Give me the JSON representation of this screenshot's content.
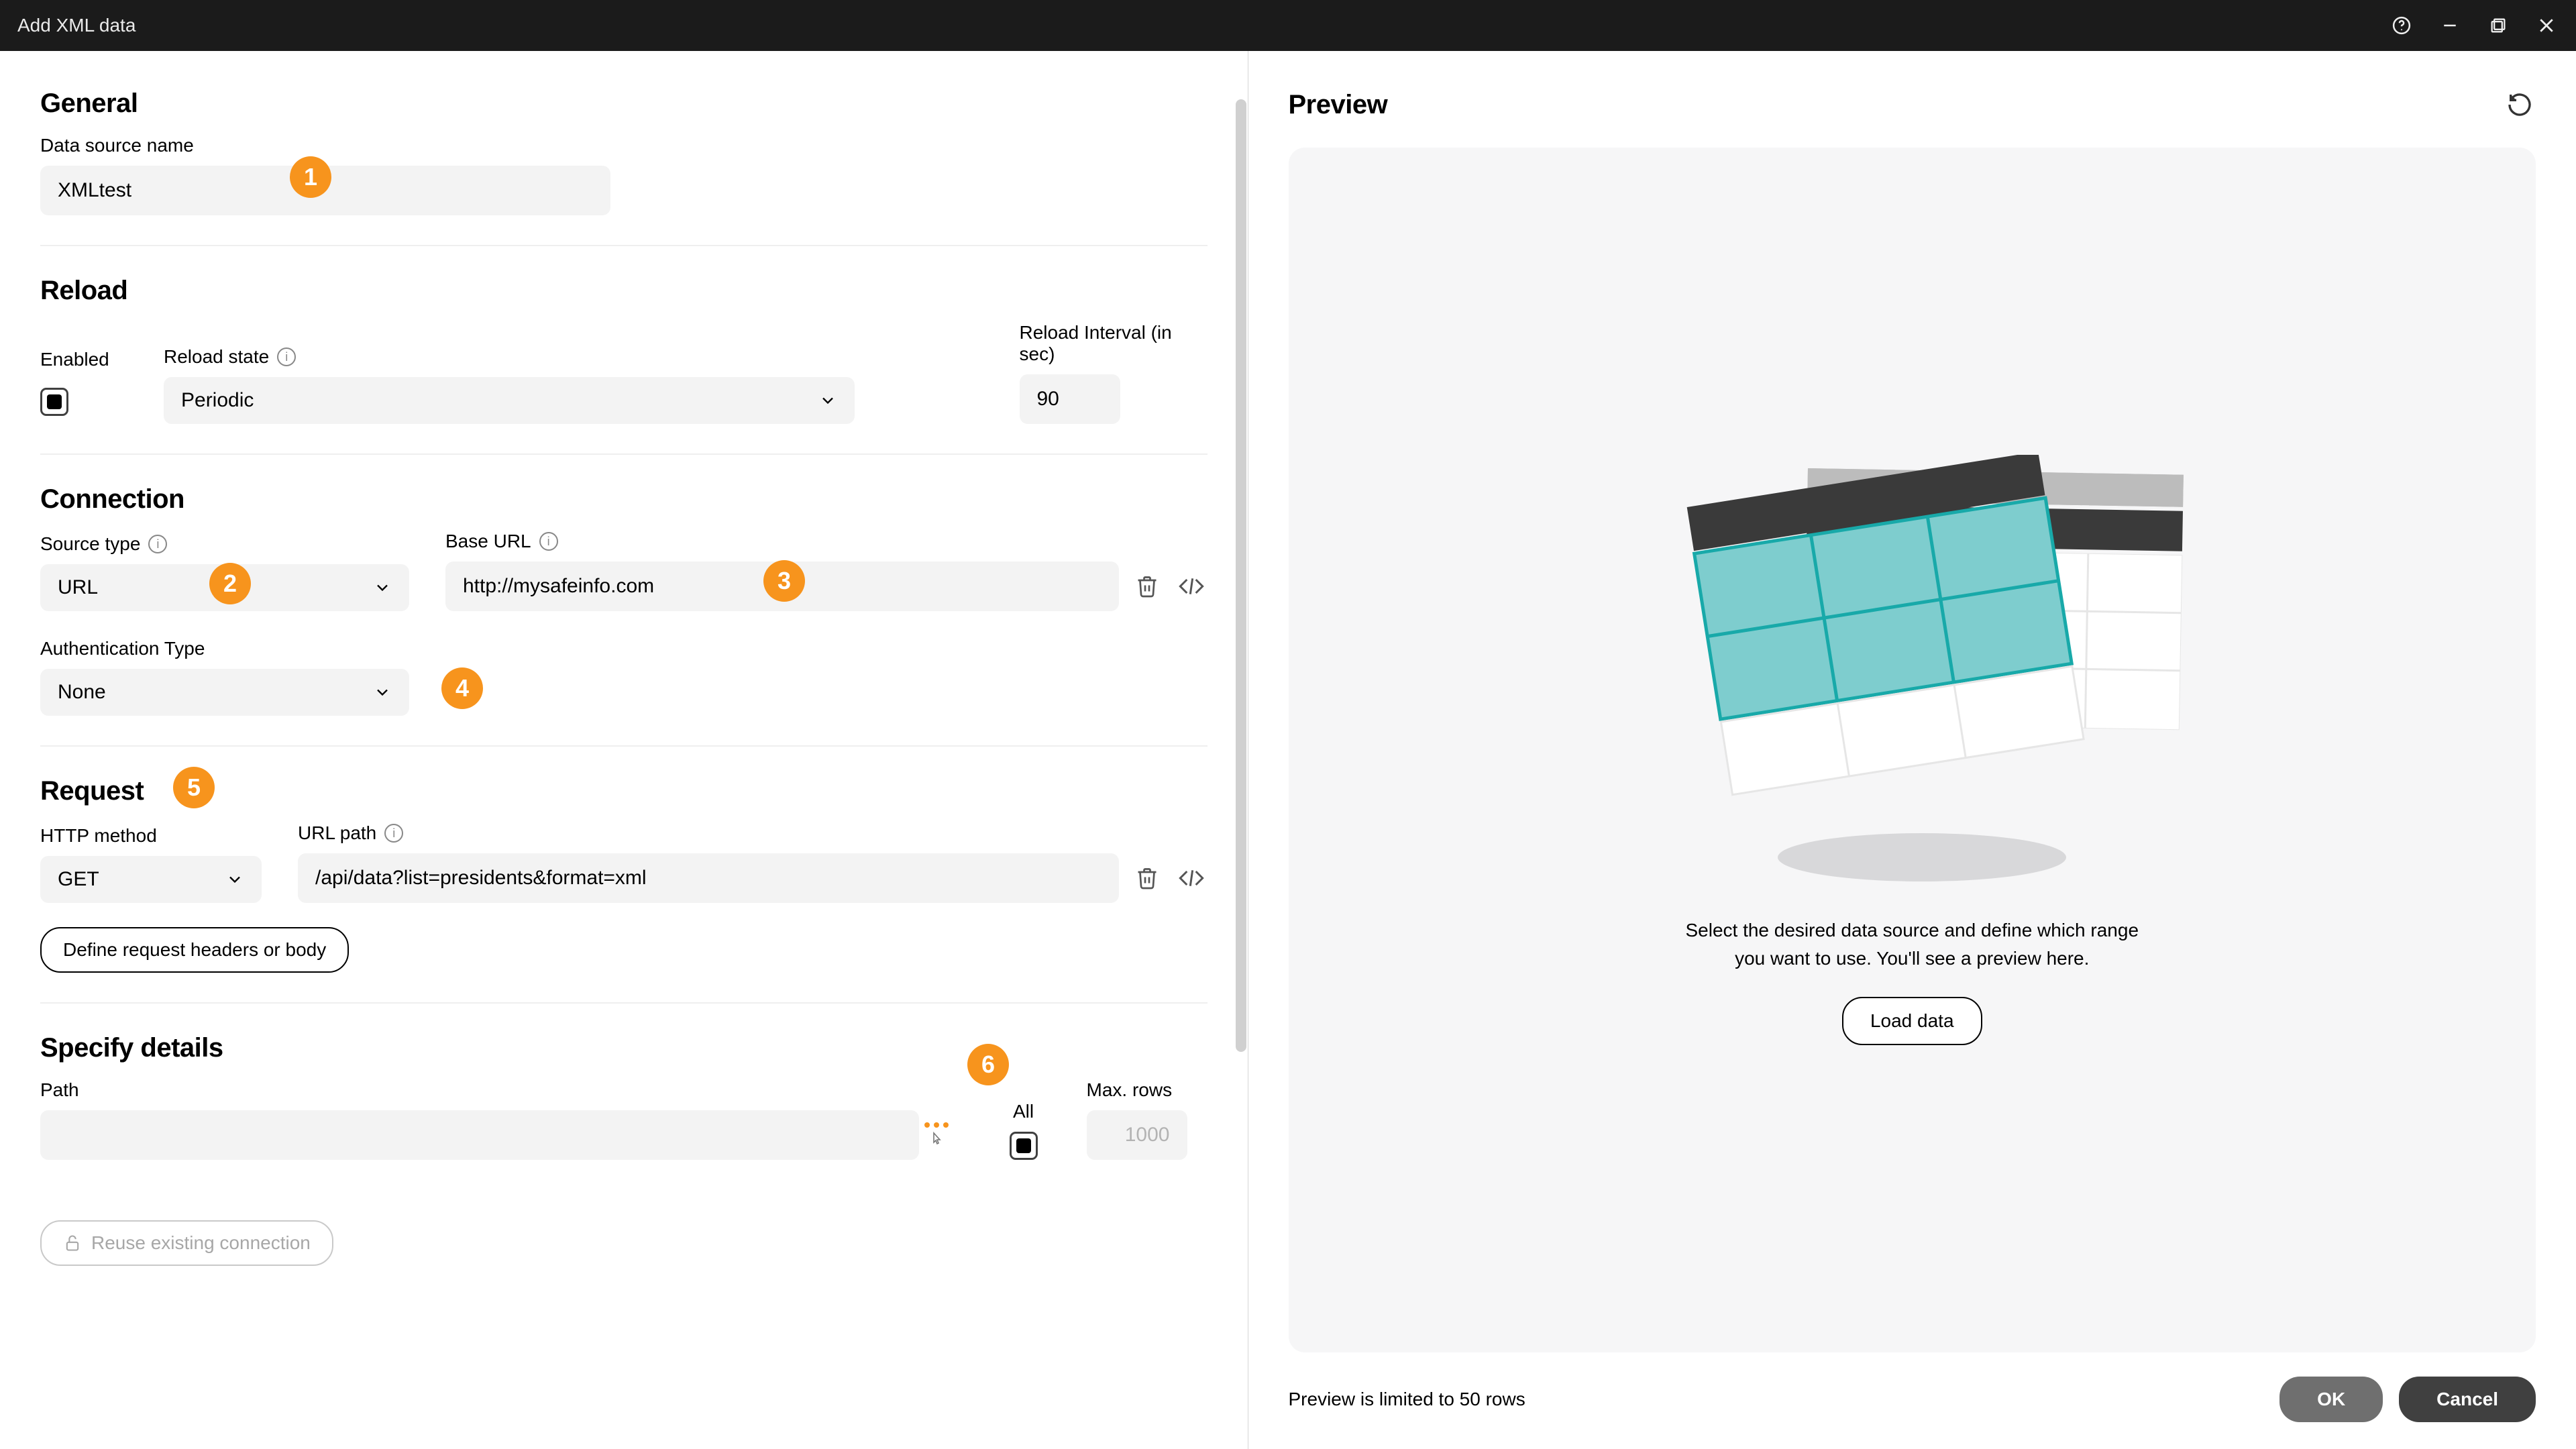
{
  "window": {
    "title": "Add XML data"
  },
  "general": {
    "heading": "General",
    "data_source_name_label": "Data source name",
    "data_source_name_value": "XMLtest"
  },
  "reload": {
    "heading": "Reload",
    "enabled_label": "Enabled",
    "reload_state_label": "Reload state",
    "reload_state_value": "Periodic",
    "reload_interval_label": "Reload Interval (in sec)",
    "reload_interval_value": "90"
  },
  "connection": {
    "heading": "Connection",
    "source_type_label": "Source type",
    "source_type_value": "URL",
    "base_url_label": "Base URL",
    "base_url_value": "http://mysafeinfo.com",
    "auth_type_label": "Authentication Type",
    "auth_type_value": "None"
  },
  "request": {
    "heading": "Request",
    "http_method_label": "HTTP method",
    "http_method_value": "GET",
    "url_path_label": "URL path",
    "url_path_value": "/api/data?list=presidents&format=xml",
    "define_headers_btn": "Define request headers or body"
  },
  "specify": {
    "heading": "Specify details",
    "path_label": "Path",
    "all_label": "All",
    "max_rows_label": "Max. rows",
    "max_rows_placeholder": "1000"
  },
  "reuse_connection_btn": "Reuse existing connection",
  "preview": {
    "heading": "Preview",
    "hint_line1": "Select the desired data source and define which range",
    "hint_line2": "you want to use. You'll see a preview here.",
    "load_btn": "Load data",
    "footer_note": "Preview is limited to 50 rows",
    "ok_btn": "OK",
    "cancel_btn": "Cancel"
  },
  "badges": {
    "b1": "1",
    "b2": "2",
    "b3": "3",
    "b4": "4",
    "b5": "5",
    "b6": "6"
  }
}
